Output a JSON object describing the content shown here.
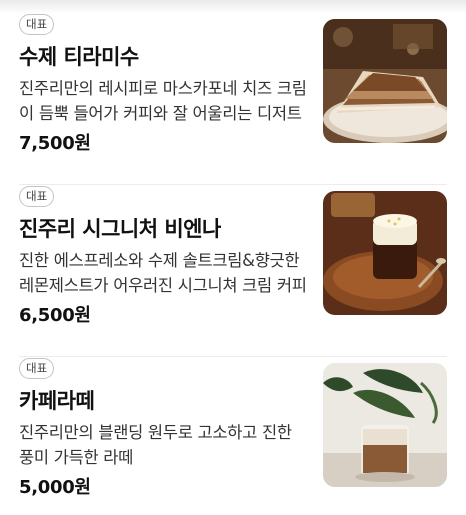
{
  "menu": {
    "items": [
      {
        "badge": "대표",
        "name": "수제 티라미수",
        "description": "진주리만의 레시피로 마스카포네 치즈 크림이 듬뿍 들어가 커피와 잘 어울리는 디저트",
        "price": "7,500원"
      },
      {
        "badge": "대표",
        "name": "진주리 시그니처 비엔나",
        "description": "진한 에스프레소와 수제 솔트크림&향긋한 레몬제스트가 어우러진 시그니쳐 크림 커피",
        "price": "6,500원"
      },
      {
        "badge": "대표",
        "name": "카페라떼",
        "description": "진주리만의 블랜딩 원두로 고소하고 진한 풍미 가득한 라떼",
        "price": "5,000원"
      }
    ]
  }
}
